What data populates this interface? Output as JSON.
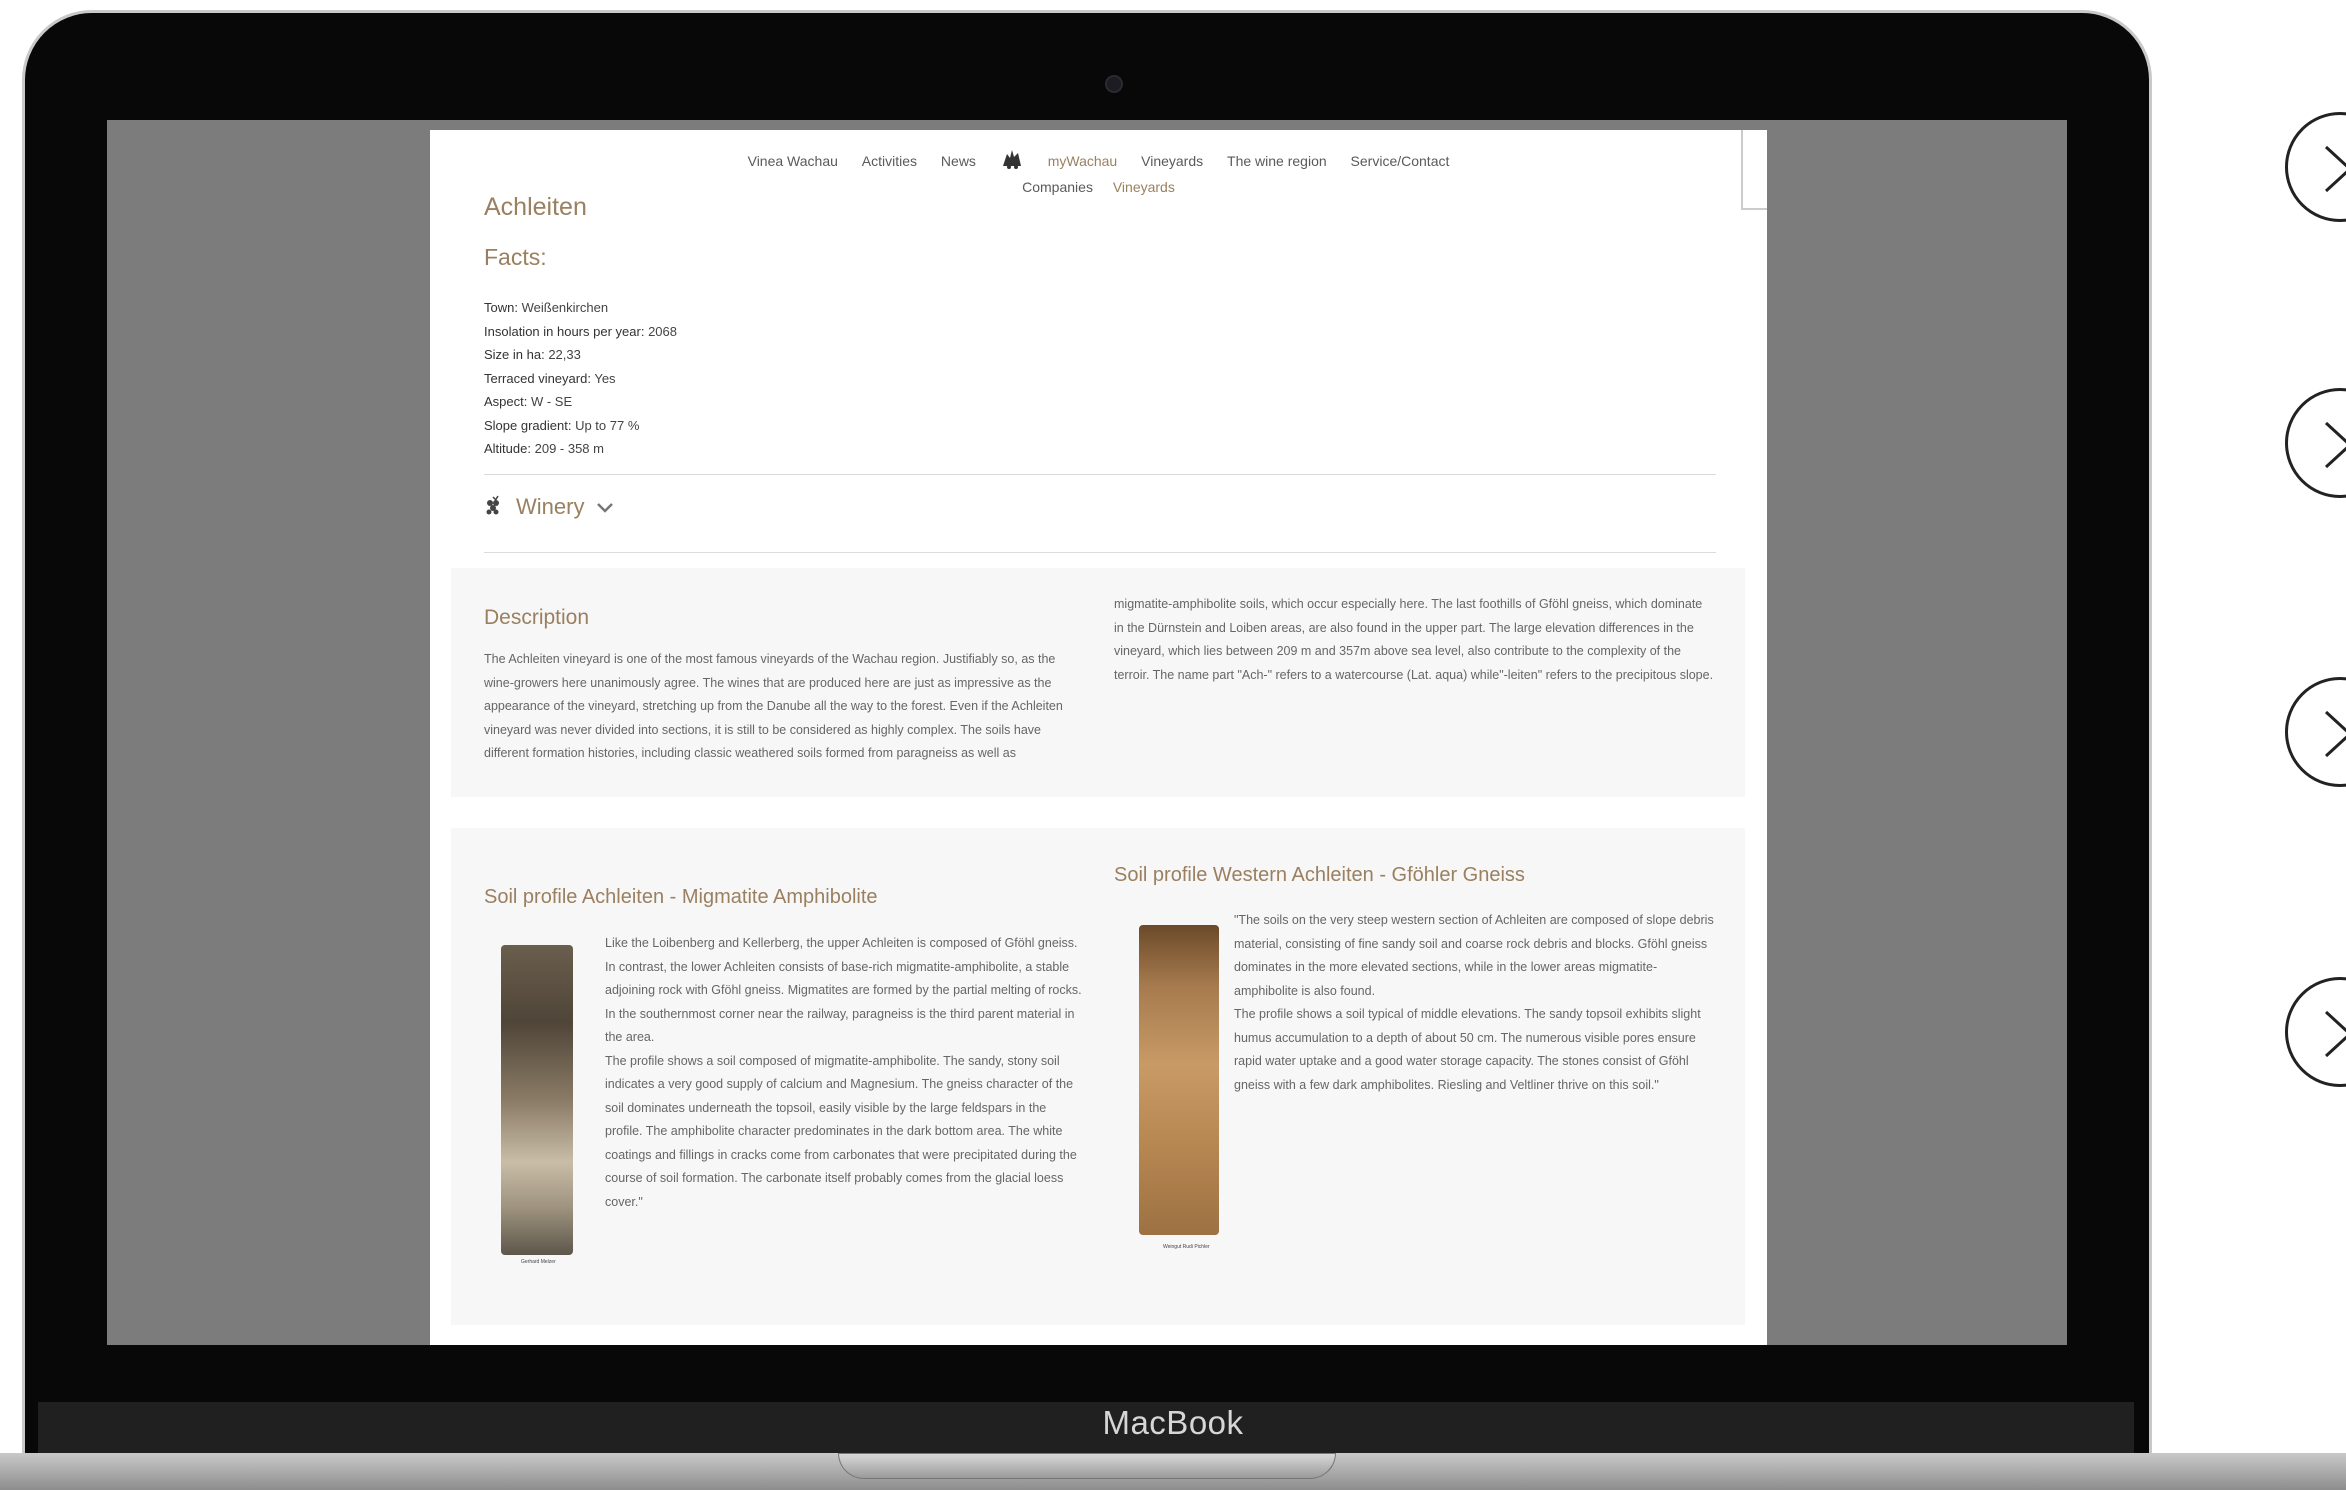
{
  "nav": {
    "items": [
      "Vinea Wachau",
      "Activities",
      "News",
      "myWachau",
      "Vineyards",
      "The wine region",
      "Service/Contact"
    ],
    "sub_items": [
      "Companies",
      "Vineyards"
    ]
  },
  "page": {
    "title": "Achleiten",
    "facts_heading": "Facts:",
    "facts": [
      {
        "k": "Town:",
        "v": "Weißenkirchen"
      },
      {
        "k": "Insolation in hours per year:",
        "v": "2068"
      },
      {
        "k": "Size in ha:",
        "v": "22,33"
      },
      {
        "k": "Terraced vineyard:",
        "v": "Yes"
      },
      {
        "k": "Aspect:",
        "v": "W - SE"
      },
      {
        "k": "Slope gradient:",
        "v": "Up to 77 %"
      },
      {
        "k": "Altitude:",
        "v": "209 - 358 m"
      }
    ],
    "winery_label": "Winery",
    "description": {
      "title": "Description",
      "col1": "The Achleiten vineyard is one of the most famous vineyards of the Wachau region. Justifiably so, as the wine-growers here unanimously agree. The wines that are produced here are just as impressive as the appearance of the vineyard, stretching up from the Danube all the way to the forest. Even if the Achleiten vineyard was never divided into sections, it is still to be considered as highly complex. The soils have different formation histories, including classic weathered soils formed from paragneiss as well as",
      "col2": "migmatite-amphibolite soils, which occur especially here. The last foothills of Gföhl gneiss, which dominate in the Dürnstein and Loiben areas, are also found in the upper part. The large elevation differences in the vineyard, which lies between 209 m and 357m above sea level, also contribute to the complexity of the terroir. The name part \"Ach-\" refers to a watercourse (Lat. aqua) while\"-leiten\" refers to the precipitous slope."
    },
    "soil1": {
      "title": "Soil profile Achleiten - Migmatite Amphibolite",
      "text": "Like the Loibenberg and Kellerberg, the upper Achleiten is composed of Gföhl gneiss. In contrast, the lower Achleiten consists of base-rich migmatite-amphibolite, a stable adjoining rock with Gföhl gneiss. Migmatites are formed by the partial melting of rocks. In the southernmost corner near the railway, paragneiss is the third parent material in the area.\nThe profile shows a soil composed of migmatite-amphibolite. The sandy, stony soil indicates a very good supply of calcium and Magnesium. The gneiss character of the soil dominates underneath the topsoil, easily visible by the large feldspars in the profile. The amphibolite character predominates in the dark bottom area. The white coatings and fillings in cracks come from carbonates that were precipitated during the course of soil formation. The carbonate itself probably comes from the glacial loess cover.\"",
      "caption": "Gerhard Melzer"
    },
    "soil2": {
      "title": "Soil profile Western Achleiten - Gföhler Gneiss",
      "text": "\"The soils on the very steep western section of Achleiten are composed of slope debris material, consisting of fine sandy soil and coarse rock debris and blocks. Gföhl gneiss dominates in the more elevated sections, while in the lower areas migmatite-amphibolite is also found.\nThe profile shows a soil typical of middle elevations. The sandy topsoil exhibits slight humus accumulation to a depth of about 50 cm. The numerous visible pores ensure rapid water uptake and a good water storage capacity. The stones consist of Gföhl gneiss with a few dark amphibolites. Riesling and Veltliner thrive on this soil.\"",
      "caption": "Weingut Rudi Pichler"
    }
  },
  "device": {
    "brand": "MacBook"
  },
  "colors": {
    "accent": "#9a8060",
    "bezel": "#080808",
    "panel": "#f7f7f7"
  },
  "icons": [
    "grape-icon",
    "chevron-down-icon",
    "close-icon",
    "logo-icon",
    "camera-icon"
  ]
}
